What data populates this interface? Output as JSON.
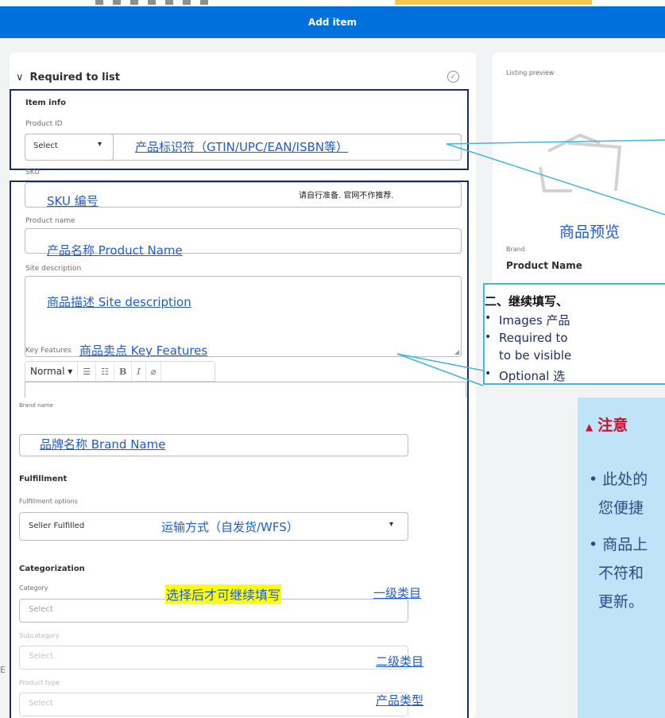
{
  "app": {
    "title": "Add item"
  },
  "section": {
    "title": "Required to list"
  },
  "item_info": {
    "heading": "Item info",
    "product_id_label": "Product ID",
    "product_id_select": "Select",
    "sku_label": "SKU",
    "product_name_label": "Product name",
    "site_description_label": "Site description",
    "key_features_label": "Key Features",
    "editor_toolbar": {
      "format": "Normal",
      "bullets": "☰",
      "numbers": "☷",
      "bold": "B",
      "italic": "I",
      "clear": "⌀"
    },
    "brand_name_label": "Brand name"
  },
  "fulfillment": {
    "heading": "Fulfillment",
    "options_label": "Fulfillment options",
    "value": "Seller Fulfilled"
  },
  "categorization": {
    "heading": "Categorization",
    "category_label": "Category",
    "category_value": "Select",
    "subcategory_label": "Subcategory",
    "subcategory_value": "Select",
    "product_type_label": "Product type",
    "product_type_value": "Select"
  },
  "preview": {
    "label": "Listing preview",
    "brand": "Brand",
    "product_name": "Product Name"
  },
  "annotations": {
    "product_id": "产品标识符（GTIN/UPC/EAN/ISBN等）",
    "sku": "SKU 编号",
    "sku_note": "请自行准备. 官网不作推荐.",
    "product_name": "产品名称 Product Name",
    "site_description": "商品描述 Site description",
    "key_features": "商品卖点 Key Features",
    "brand_name": "品牌名称 Brand Name",
    "fulfillment": "运输方式（自发货/WFS）",
    "choose_first": "选择后才可继续填写",
    "category_level1": "一级类目",
    "category_level2": "二级类目",
    "product_type": "产品类型",
    "preview": "商品预览"
  },
  "callout": {
    "heading": "二、继续填写、",
    "bullets": [
      "Images 产品",
      "Required to",
      "to be visible",
      "Optional 选"
    ]
  },
  "attention": {
    "title": "注意",
    "lines": [
      "• 此处的",
      "您便捷",
      "• 商品上",
      "不符和",
      "更新。"
    ]
  },
  "edge_text": "E",
  "colors": {
    "brand_blue": "#0071dc",
    "frame": "#1a2d6b",
    "callout_border": "#44b3e8",
    "attention_bg": "#bfe3f7",
    "highlight": "#ffff00"
  }
}
